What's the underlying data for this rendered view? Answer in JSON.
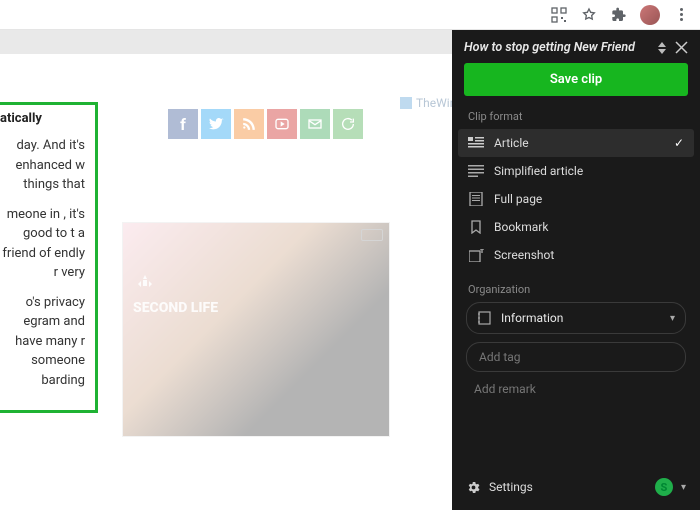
{
  "toolbar": {
    "icons": [
      "qr-icon",
      "star-icon",
      "puzzle-icon",
      "avatar",
      "menu-dots"
    ]
  },
  "page": {
    "heading_fragment": "atically",
    "para1": "day. And it's enhanced w things that",
    "para2": "meone in , it's good to t a friend of endly r very",
    "para3": "o's privacy egram and have many r someone barding",
    "watermark": "TheWindowsClub",
    "social_icons": [
      "facebook",
      "twitter",
      "rss",
      "youtube",
      "email",
      "refresh"
    ],
    "ad_brand": "SECOND LIFE"
  },
  "clipper": {
    "title": "How to stop getting New Friend",
    "save_label": "Save clip",
    "format_label": "Clip format",
    "formats": [
      {
        "icon": "article",
        "label": "Article",
        "selected": true
      },
      {
        "icon": "simplified",
        "label": "Simplified article",
        "selected": false
      },
      {
        "icon": "fullpage",
        "label": "Full page",
        "selected": false
      },
      {
        "icon": "bookmark",
        "label": "Bookmark",
        "selected": false
      },
      {
        "icon": "screenshot",
        "label": "Screenshot",
        "selected": false
      }
    ],
    "org_label": "Organization",
    "notebook": "Information",
    "tag_placeholder": "Add tag",
    "remark_placeholder": "Add remark",
    "settings_label": "Settings",
    "account_initial": "S"
  }
}
